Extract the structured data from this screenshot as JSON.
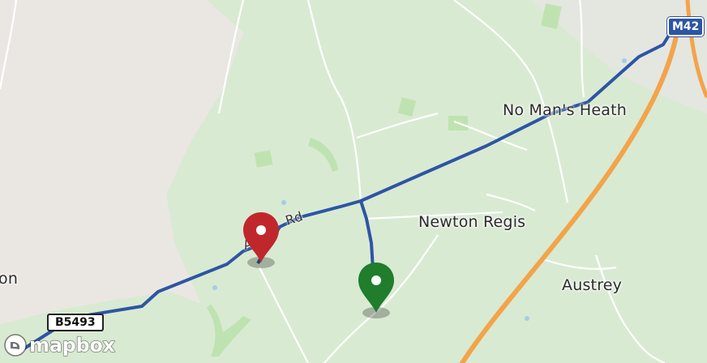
{
  "map": {
    "places": {
      "no_mans_heath": "No Man's Heath",
      "newton_regis": "Newton Regis",
      "austrey": "Austrey",
      "left_edge_place": "on"
    },
    "roads": {
      "rd_label": "Rd",
      "rd_prefix": "A",
      "b5493": "B5493",
      "m42": "M42"
    },
    "markers": [
      {
        "name": "start",
        "color": "#c0272d",
        "icon": "map-pin-icon"
      },
      {
        "name": "end",
        "color": "#1f7d2c",
        "icon": "map-pin-icon"
      }
    ],
    "route_color": "#2d55a5",
    "attribution": {
      "logo_text": "mapbox"
    }
  }
}
